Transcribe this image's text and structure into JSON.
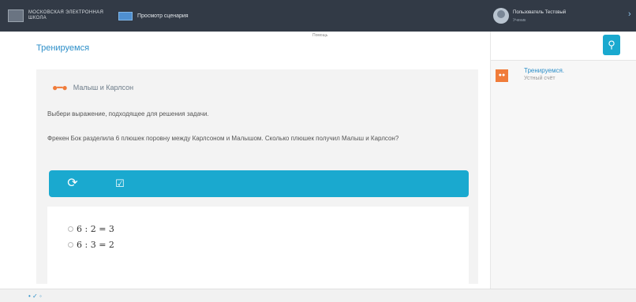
{
  "topbar": {
    "logo_text": "МОСКОВСКАЯ ЭЛЕКТРОННАЯ ШКОЛА",
    "nav_label": "Просмотр сценария",
    "user_name": "Пользователь Тестовый",
    "user_role": "Ученик",
    "hint": "Помощь",
    "colors": {
      "bar": "#323a46",
      "accent": "#1aa9cf"
    }
  },
  "page": {
    "title": "Тренируемся"
  },
  "card": {
    "title": "Малыш и Карлсон",
    "icon": "dumbbell-icon",
    "instruction": "Выбери выражение, подходящее для решения задачи.",
    "problem": "Фрекен Бок разделила 6 плюшек поровну между Карлсоном и Малышом. Сколько плюшек получил Малыш и Карлсон?",
    "toolbar": {
      "reload_icon": "reload-icon",
      "check_icon": "check-icon"
    },
    "options": [
      "6 : 2 = 3",
      "6 : 3 = 2"
    ]
  },
  "sidebar": {
    "search_icon": "search-icon",
    "item_title": "Тренируемся.",
    "item_subtitle": "Устный счёт"
  },
  "bottom": {
    "marks": "• ✓ ◦"
  }
}
